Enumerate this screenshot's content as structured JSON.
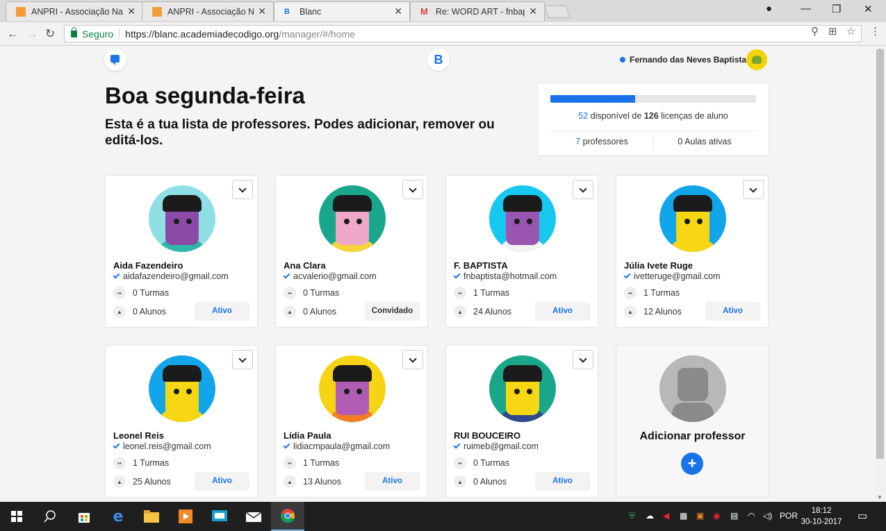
{
  "browser": {
    "tabs": [
      {
        "title": "ANPRI - Associação Naci",
        "favicon": "#f29d38",
        "active": false
      },
      {
        "title": "ANPRI - Associação Naci",
        "favicon": "#f29d38",
        "active": false
      },
      {
        "title": "Blanc",
        "favicon": "#1a73e8",
        "active": true
      },
      {
        "title": "Re: WORD ART - fnbaptis",
        "favicon": "#d44638",
        "active": false
      }
    ],
    "secure_label": "Seguro",
    "url_host": "https://blanc.academiadecodigo.org",
    "url_path": "/manager/#/home"
  },
  "header": {
    "logo_letter": "B",
    "user_name": "Fernando das Neves Baptista"
  },
  "greeting": "Boa segunda-feira",
  "subtitle": "Esta é a tua lista de professores. Podes adicionar, remover ou editá-los.",
  "licenses": {
    "available": "52",
    "available_label": "disponível de",
    "total": "126",
    "total_label": "licenças de aluno",
    "fraction_used": 0.413,
    "teachers_count": "7",
    "teachers_label": "professores",
    "classes_count": "0",
    "classes_label": "Aulas ativas"
  },
  "teachers": [
    {
      "name": "Aida Fazendeiro",
      "email": "aidafazendeiro@gmail.com",
      "classes": "0 Turmas",
      "students": "0 Alunos",
      "status": "Ativo",
      "bg": "#8ee0e5",
      "face": "#8b4aa8",
      "hair": "#1b1b1b",
      "body": "#2fb6a8"
    },
    {
      "name": "Ana Clara",
      "email": "acvalerio@gmail.com",
      "classes": "0 Turmas",
      "students": "0 Alunos",
      "status": "Convidado",
      "bg": "#1aa68a",
      "face": "#f0a8c8",
      "hair": "#1b1b1b",
      "body": "#f6d438"
    },
    {
      "name": "F. BAPTISTA",
      "email": "fnbaptista@hotmail.com",
      "classes": "1 Turmas",
      "students": "24 Alunos",
      "status": "Ativo",
      "bg": "#18c7ee",
      "face": "#9a55b0",
      "hair": "#1b1b1b",
      "body": "#f3f3f3"
    },
    {
      "name": "Júlia Ivete Ruge",
      "email": "ivetteruge@gmail.com",
      "classes": "1 Turmas",
      "students": "12 Alunos",
      "status": "Ativo",
      "bg": "#13a5ea",
      "face": "#f7d714",
      "hair": "#1b1b1b",
      "body": "#f7d714"
    },
    {
      "name": "Leonel Reis",
      "email": "leonel.reis@gmail.com",
      "classes": "1 Turmas",
      "students": "25 Alunos",
      "status": "Ativo",
      "bg": "#13a5ea",
      "face": "#f7d714",
      "hair": "#1b1b1b",
      "body": "#f7d714"
    },
    {
      "name": "Lídia Paula",
      "email": "lidiacmpaula@gmail.com",
      "classes": "1 Turmas",
      "students": "13 Alunos",
      "status": "Ativo",
      "bg": "#f6d414",
      "face": "#b05cb4",
      "hair": "#1b1b1b",
      "body": "#f27d22"
    },
    {
      "name": "RUI BOUCEIRO",
      "email": "ruimeb@gmail.com",
      "classes": "0 Turmas",
      "students": "0 Alunos",
      "status": "Ativo",
      "bg": "#1aa68a",
      "face": "#f7d714",
      "hair": "#1b1b1b",
      "body": "#2f4a8c"
    }
  ],
  "add_teacher_label": "Adicionar professor",
  "taskbar": {
    "language": "POR",
    "time": "18:12",
    "date": "30-10-2017"
  }
}
